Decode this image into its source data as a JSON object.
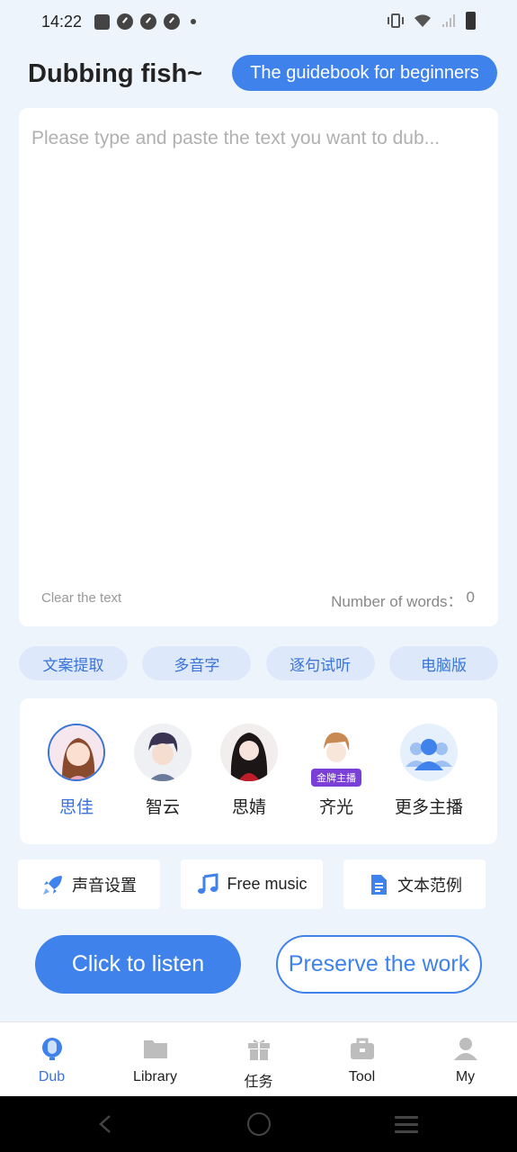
{
  "status_bar": {
    "time": "14:22"
  },
  "header": {
    "app_title": "Dubbing fish~",
    "guide_button": "The guidebook for beginners"
  },
  "editor": {
    "placeholder": "Please type and paste the text you want to dub...",
    "value": "",
    "clear_label": "Clear the text",
    "word_count_label": "Number of words：",
    "word_count": "0"
  },
  "chips": [
    "文案提取",
    "多音字",
    "逐句试听",
    "电脑版"
  ],
  "voices": [
    {
      "name": "思佳",
      "selected": true,
      "avatar_icon": "female-avatar-1"
    },
    {
      "name": "智云",
      "selected": false,
      "avatar_icon": "male-avatar-1"
    },
    {
      "name": "思婧",
      "selected": false,
      "avatar_icon": "female-avatar-2"
    },
    {
      "name": "齐光",
      "selected": false,
      "avatar_icon": "male-avatar-2",
      "tag": "金牌主播"
    },
    {
      "name": "更多主播",
      "selected": false,
      "avatar_icon": "more-users-icon"
    }
  ],
  "tools": [
    {
      "label": "声音设置",
      "icon": "rocket-icon"
    },
    {
      "label": "Free music",
      "icon": "music-note-icon"
    },
    {
      "label": "文本范例",
      "icon": "document-icon"
    }
  ],
  "actions": {
    "listen": "Click to listen",
    "preserve": "Preserve the work"
  },
  "bottom_nav": [
    {
      "label": "Dub",
      "icon": "microphone-icon",
      "active": true
    },
    {
      "label": "Library",
      "icon": "folder-icon",
      "active": false
    },
    {
      "label": "任务",
      "icon": "gift-icon",
      "active": false
    },
    {
      "label": "Tool",
      "icon": "toolbox-icon",
      "active": false
    },
    {
      "label": "My",
      "icon": "user-icon",
      "active": false
    }
  ],
  "colors": {
    "accent": "#3f82ec",
    "background": "#eef4fc",
    "chip_bg": "#dde9fb",
    "tag_purple": "#7a3fd6"
  }
}
